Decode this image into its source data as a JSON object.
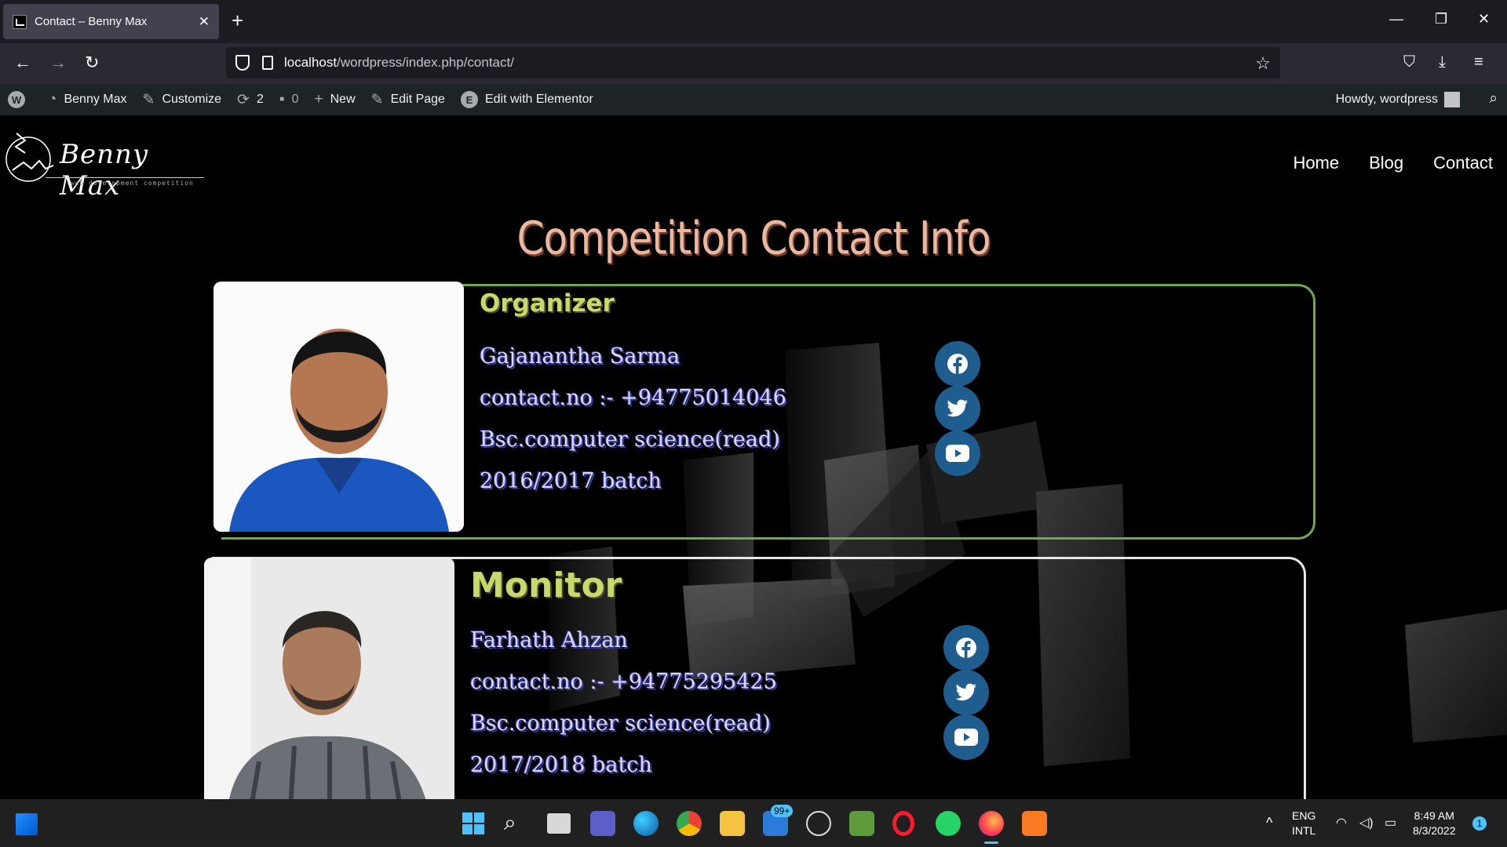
{
  "browser": {
    "tab_title": "Contact – Benny Max",
    "url_host": "localhost",
    "url_path": "/wordpress/index.php/contact/"
  },
  "adminbar": {
    "site_name": "Benny Max",
    "customize": "Customize",
    "updates_count": "2",
    "comments_count": "0",
    "new_label": "New",
    "edit_page": "Edit Page",
    "edit_elementor": "Edit with Elementor",
    "howdy": "Howdy, wordpress"
  },
  "site": {
    "logo_text": "Benny Max",
    "logo_subtitle": "-web development competition",
    "menu": [
      "Home",
      "Blog",
      "Contact"
    ],
    "page_title": "Competition Contact Info"
  },
  "cards": [
    {
      "role": "Organizer",
      "name": "Gajanantha Sarma",
      "contact": "contact.no :- +94775014046",
      "degree": "Bsc.computer science(read)",
      "batch": "2016/2017 batch",
      "border_color": "#6fa84a"
    },
    {
      "role": "Monitor",
      "name": "Farhath Ahzan",
      "contact": "contact.no :- +94775295425",
      "degree": "Bsc.computer science(read)",
      "batch": "2017/2018 batch",
      "border_color": "#e6e6e6"
    }
  ],
  "taskbar": {
    "mail_badge": "99+",
    "lang": "ENG",
    "layout": "INTL",
    "time": "8:49 AM",
    "date": "8/3/2022",
    "notification_count": "1"
  },
  "colors": {
    "accent_social": "#1f5d8e",
    "title": "#e8b8a0",
    "role": "#c8d86a"
  }
}
